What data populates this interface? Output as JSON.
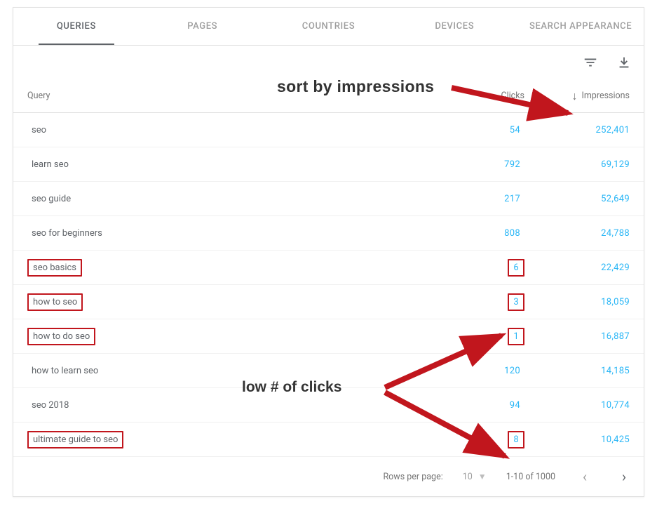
{
  "tabs": {
    "items": [
      {
        "label": "QUERIES",
        "active": true
      },
      {
        "label": "PAGES",
        "active": false
      },
      {
        "label": "COUNTRIES",
        "active": false
      },
      {
        "label": "DEVICES",
        "active": false
      },
      {
        "label": "SEARCH APPEARANCE",
        "active": false
      }
    ]
  },
  "columns": {
    "query": "Query",
    "clicks": "Clicks",
    "impressions": "Impressions"
  },
  "sort_glyph": "↓",
  "rows": [
    {
      "query": "seo",
      "clicks": "54",
      "impressions": "252,401",
      "box_query": false,
      "box_clicks": false
    },
    {
      "query": "learn seo",
      "clicks": "792",
      "impressions": "69,129",
      "box_query": false,
      "box_clicks": false
    },
    {
      "query": "seo guide",
      "clicks": "217",
      "impressions": "52,649",
      "box_query": false,
      "box_clicks": false
    },
    {
      "query": "seo for beginners",
      "clicks": "808",
      "impressions": "24,788",
      "box_query": false,
      "box_clicks": false
    },
    {
      "query": "seo basics",
      "clicks": "6",
      "impressions": "22,429",
      "box_query": true,
      "box_clicks": true
    },
    {
      "query": "how to seo",
      "clicks": "3",
      "impressions": "18,059",
      "box_query": true,
      "box_clicks": true
    },
    {
      "query": "how to do seo",
      "clicks": "1",
      "impressions": "16,887",
      "box_query": true,
      "box_clicks": true
    },
    {
      "query": "how to learn seo",
      "clicks": "120",
      "impressions": "14,185",
      "box_query": false,
      "box_clicks": false
    },
    {
      "query": "seo 2018",
      "clicks": "94",
      "impressions": "10,774",
      "box_query": false,
      "box_clicks": false
    },
    {
      "query": "ultimate guide to seo",
      "clicks": "8",
      "impressions": "10,425",
      "box_query": true,
      "box_clicks": true
    }
  ],
  "footer": {
    "rows_per_page_label": "Rows per page:",
    "rows_per_page_value": "10",
    "range": "1-10 of 1000",
    "prev_glyph": "‹",
    "next_glyph": "›"
  },
  "annotations": {
    "sort_text": "sort by impressions",
    "clicks_text": "low # of clicks"
  },
  "colors": {
    "link": "#29b6f6",
    "annotation_box": "#c1161d"
  }
}
